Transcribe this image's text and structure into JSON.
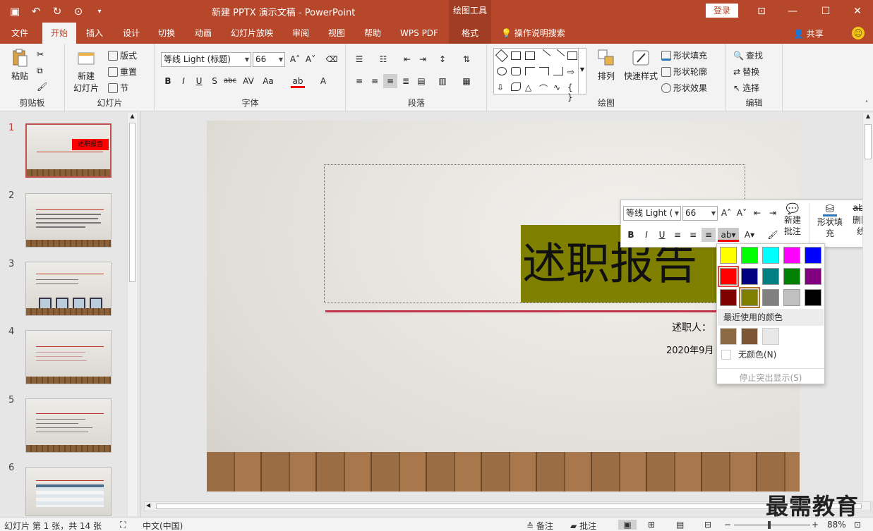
{
  "titlebar": {
    "title": "新建 PPTX 演示文稿  -  PowerPoint",
    "context_tab": "绘图工具",
    "login": "登录"
  },
  "tabs": [
    "文件",
    "开始",
    "插入",
    "设计",
    "切换",
    "动画",
    "幻灯片放映",
    "审阅",
    "视图",
    "帮助",
    "WPS PDF",
    "格式"
  ],
  "active_tab": "开始",
  "tell_me": "操作说明搜索",
  "share": "共享",
  "ribbon": {
    "clipboard": {
      "paste": "粘贴",
      "label": "剪贴板"
    },
    "slides": {
      "new_slide_1": "新建",
      "new_slide_2": "幻灯片",
      "layout": "版式",
      "reset": "重置",
      "section": "节",
      "label": "幻灯片"
    },
    "font": {
      "font_name": "等线 Light (标题)",
      "font_size": "66",
      "label": "字体"
    },
    "paragraph": {
      "label": "段落"
    },
    "drawing": {
      "arrange": "排列",
      "quick_styles": "快速样式",
      "fill": "形状填充",
      "outline": "形状轮廓",
      "effects": "形状效果",
      "label": "绘图"
    },
    "editing": {
      "find": "查找",
      "replace": "替换",
      "select": "选择",
      "label": "编辑"
    }
  },
  "thumbnails": [
    {
      "num": "1",
      "title": "述职报告"
    },
    {
      "num": "2",
      "title": ""
    },
    {
      "num": "3",
      "title": ""
    },
    {
      "num": "4",
      "title": ""
    },
    {
      "num": "5",
      "title": ""
    },
    {
      "num": "6",
      "title": ""
    }
  ],
  "selected_slide": "1",
  "slide": {
    "title": "述职报告",
    "reporter": "述职人：",
    "date": "2020年9月"
  },
  "minibar": {
    "font_name": "等线 Light (",
    "font_size": "66",
    "new_comment_1": "新建",
    "new_comment_2": "批注",
    "shape_fill_1": "形状填",
    "shape_fill_2": "充",
    "strikethrough_1": "删除",
    "strikethrough_2": "线"
  },
  "color_popup": {
    "standard_colors": [
      "#ffff00",
      "#00ff00",
      "#00ffff",
      "#ff00ff",
      "#0000ff",
      "#ff0000",
      "#000080",
      "#008080",
      "#008000",
      "#800080",
      "#800000",
      "#808000",
      "#808080",
      "#c0c0c0",
      "#000000"
    ],
    "recent_label": "最近使用的颜色",
    "recent_colors": [
      "#8b6a44",
      "#7d5735",
      "#e8e8e8"
    ],
    "no_color": "无颜色(N)",
    "stop_highlight": "停止突出显示(S)"
  },
  "statusbar": {
    "slide_info": "幻灯片 第 1 张，共 14 张",
    "language": "中文(中国)",
    "notes": "备注",
    "comments": "批注",
    "zoom": "88%"
  },
  "watermark": "最需教育"
}
